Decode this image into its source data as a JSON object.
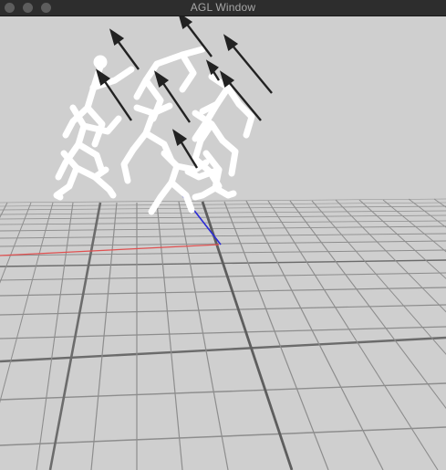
{
  "window": {
    "title": "AGL Window",
    "controls": [
      "close",
      "minimize",
      "maximize"
    ]
  },
  "scene": {
    "background_color": "#cfcfcf",
    "grid_color": "#8a8a8a",
    "x_axis_color": "#e04040",
    "z_axis_color": "#3030d0",
    "figure_color": "#ffffff",
    "arrow_color": "#222222",
    "figure_count": 9,
    "arrow_count": 8
  }
}
